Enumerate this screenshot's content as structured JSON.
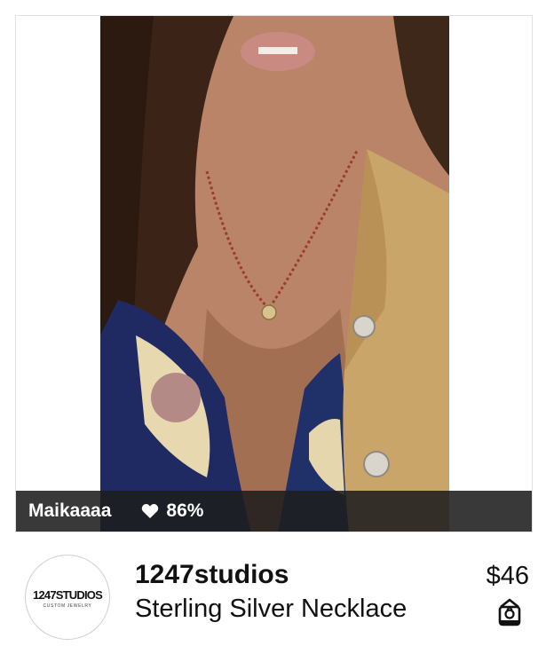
{
  "post": {
    "username": "Maikaaaa",
    "like_percent": "86%",
    "icons": {
      "likes": "heart-icon",
      "photo": "photo"
    }
  },
  "product": {
    "shop_name": "1247studios",
    "title": "Sterling Silver Necklace",
    "price": "$46",
    "icons": {
      "avatar": "shop-logo",
      "category": "ring-box-icon"
    }
  },
  "logo": {
    "wordmark": "1247STUDIOS",
    "tagline": "CUSTOM JEWELRY"
  },
  "colors": {
    "caption_bar": "#1e1e1e",
    "text": "#111111",
    "caption_text": "#ffffff"
  }
}
